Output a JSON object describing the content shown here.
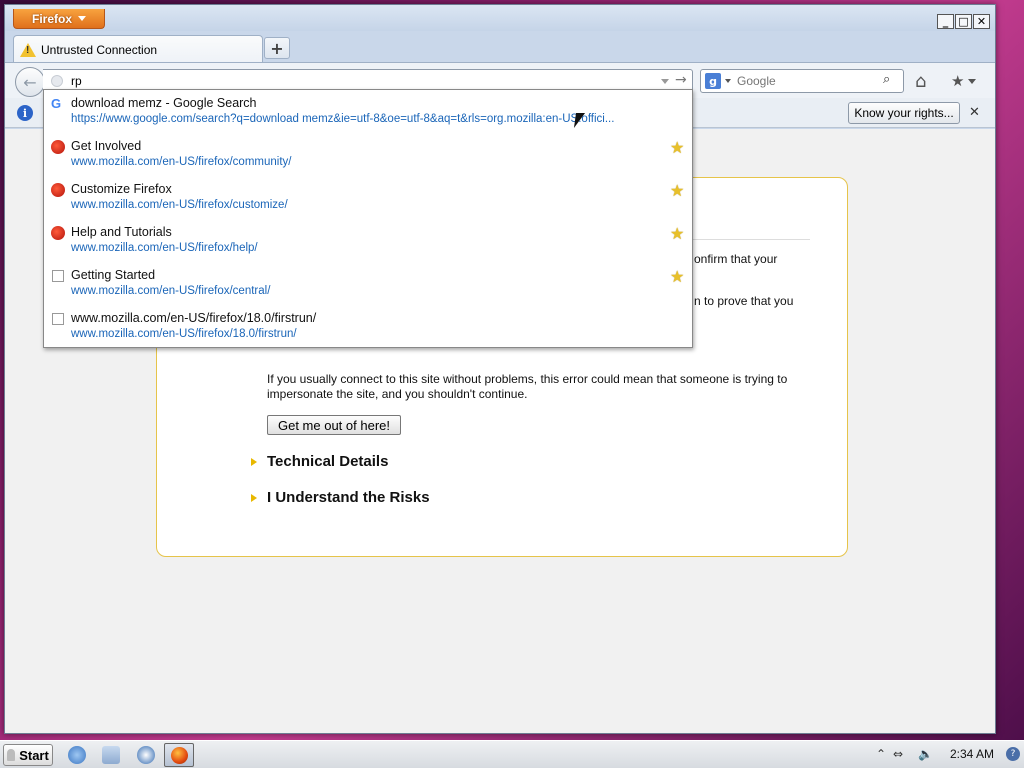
{
  "window": {
    "app_menu_label": "Firefox",
    "minimize_symbol": "_",
    "maximize_symbol": "□",
    "close_symbol": "✕"
  },
  "tabs": [
    {
      "label": "Untrusted Connection",
      "icon": "warning-icon"
    }
  ],
  "new_tab_symbol": "+",
  "navbar": {
    "back_symbol": "←",
    "url_value": "rp",
    "go_symbol": "→",
    "search_engine_symbol": "g",
    "search_placeholder": "Google",
    "search_symbol": "⌕",
    "home_symbol": "⌂",
    "bookmarks_symbol": "★"
  },
  "notification": {
    "info_symbol": "i",
    "know_rights_label": "Know your rights...",
    "close_symbol": "✕"
  },
  "autocomplete": [
    {
      "icon": "google-icon",
      "title": "download memz - Google Search",
      "url": "https://www.google.com/search?q=download memz&ie=utf-8&oe=utf-8&aq=t&rls=org.mozilla:en-US:offici...",
      "bookmarked": false
    },
    {
      "icon": "firefox-page-icon",
      "title": "Get Involved",
      "url": "www.mozilla.com/en-US/firefox/community/",
      "bookmarked": true
    },
    {
      "icon": "firefox-page-icon",
      "title": "Customize Firefox",
      "url": "www.mozilla.com/en-US/firefox/customize/",
      "bookmarked": true
    },
    {
      "icon": "firefox-page-icon",
      "title": "Help and Tutorials",
      "url": "www.mozilla.com/en-US/firefox/help/",
      "bookmarked": true
    },
    {
      "icon": "blank-page-icon",
      "title": "Getting Started",
      "url": "www.mozilla.com/en-US/firefox/central/",
      "bookmarked": true
    },
    {
      "icon": "blank-page-icon",
      "title": "www.mozilla.com/en-US/firefox/18.0/firstrun/",
      "url": "www.mozilla.com/en-US/firefox/18.0/firstrun/",
      "bookmarked": false
    }
  ],
  "star_symbol": "★",
  "error_page": {
    "fragment_1": "onfirm that your",
    "fragment_2": "n to prove that you",
    "paragraph": "If you usually connect to this site without problems, this error could mean that someone is trying to impersonate the site, and you shouldn't continue.",
    "get_out_label": "Get me out of here!",
    "technical_details_label": "Technical Details",
    "understand_risks_label": "I Understand the Risks"
  },
  "taskbar": {
    "start_label": "Start",
    "clock": "2:34 AM",
    "tray_chevron": "⌃",
    "tray_network": "⇔",
    "tray_volume": "🔈",
    "tray_help": "?"
  },
  "colors": {
    "firefox_orange": "#e0701b",
    "link_blue": "#1a65b8",
    "star_gold": "#e8c02a",
    "error_border": "#e6c44a"
  }
}
